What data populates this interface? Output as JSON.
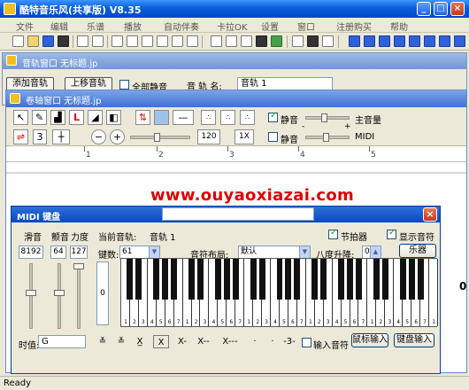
{
  "app": {
    "title": "酷特音乐风(共享版) V8.35"
  },
  "menu": [
    "文件",
    "编辑",
    "乐谱",
    "播放",
    "自动伴奏",
    "卡拉OK",
    "设置",
    "窗口",
    "注册购买",
    "帮助"
  ],
  "track_window": {
    "title": "音轨窗口  无标题.jp",
    "add_track": "添加音轨",
    "move_up": "上移音轨",
    "mute_all": "全部静音",
    "track_name_label": "音 轨 名:",
    "track_name_value": "音轨 1"
  },
  "roll_window": {
    "title": "卷轴窗口  无标题.jp",
    "num_3": "3",
    "tempo": "120",
    "speed": "1X",
    "mute1": "静音",
    "mute2": "静音",
    "master_volume": "主音量",
    "midi_label": "MIDI",
    "minus": "-",
    "plus": "+",
    "ruler": [
      "1",
      "2",
      "3",
      "4",
      "5"
    ],
    "right_number": "0"
  },
  "watermark": "www.ouyaoxiazai.com",
  "midi_dialog": {
    "title": "MIDI 键盘",
    "labels": {
      "pitch": "滑音",
      "mod": "颤音",
      "vel": "力度",
      "current_track": "当前音轨:",
      "current_track_value": "音轨 1",
      "metronome": "节拍器",
      "show_notes": "显示音符",
      "instrument": "乐器",
      "key_count": "键数:",
      "key_count_value": "61",
      "layout": "音符布局:",
      "layout_value": "默认",
      "octave": "八度升降:",
      "octave_value": "0",
      "duration": "时值:",
      "duration_value": "G",
      "input_note": "输入音符",
      "mouse_input": "鼠标输入",
      "keyboard_input": "键盘输入"
    },
    "values": {
      "pitch": "8192",
      "mod": "64",
      "vel": "127",
      "left_zero": "0"
    },
    "duration_icons": [
      "X",
      "X-",
      "X--",
      "X---",
      "·",
      "·",
      "-3-"
    ],
    "key_numbers": [
      "1",
      "2",
      "3",
      "4",
      "5",
      "6",
      "7",
      "1",
      "2",
      "3",
      "4",
      "5",
      "6",
      "7",
      "1",
      "2",
      "3",
      "4",
      "5",
      "6",
      "7",
      "1",
      "2",
      "3",
      "4",
      "5",
      "6",
      "7",
      "1",
      "2",
      "3",
      "4",
      "5",
      "6",
      "7",
      "1"
    ]
  },
  "status": "Ready"
}
